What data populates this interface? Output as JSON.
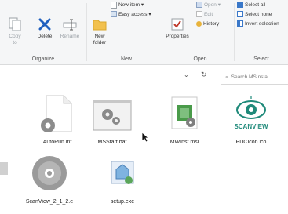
{
  "ribbon": {
    "organize": {
      "copy_to": "Copy\nto",
      "delete": "Delete",
      "rename": "Rename",
      "label": "Organize"
    },
    "new": {
      "new_folder": "New\nfolder",
      "new_item": "New item",
      "easy_access": "Easy access",
      "label": "New"
    },
    "open": {
      "properties": "Properties",
      "open": "Open",
      "edit": "Edit",
      "history": "History",
      "label": "Open"
    },
    "select": {
      "select_all": "Select all",
      "select_none": "Select none",
      "invert": "Invert selection",
      "label": "Select"
    }
  },
  "address": {
    "search_placeholder": "Search MSInstal"
  },
  "files": [
    {
      "name": "AutoRun.inf",
      "icon": "settings-file-icon"
    },
    {
      "name": "MSStart.bat",
      "icon": "batch-file-icon"
    },
    {
      "name": "MWInst.msi",
      "icon": "installer-package-icon"
    },
    {
      "name": "PDCIcon.ico",
      "icon": "scanview-logo-icon"
    },
    {
      "name": "ScanView_2_1_2.e",
      "icon": "disc-icon"
    },
    {
      "name": "setup.exe",
      "icon": "setup-exe-icon"
    }
  ],
  "icon_text": {
    "scanview": "SCANVIEW"
  }
}
